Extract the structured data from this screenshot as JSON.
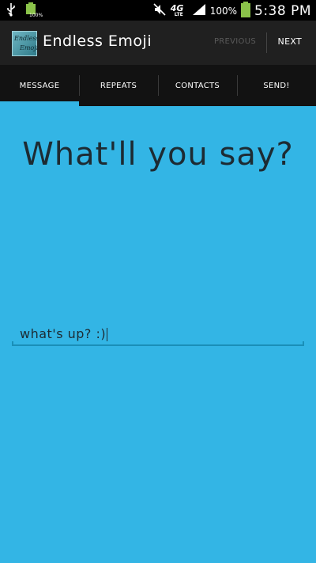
{
  "status_bar": {
    "battery_small_percent": "100%",
    "network_label": "4G",
    "network_sublabel": "LTE",
    "battery_percent": "100%",
    "time": "5:38 PM"
  },
  "action_bar": {
    "app_title": "Endless Emoji",
    "icon_text_line1": "Endless",
    "icon_text_line2": "Emoji",
    "previous_label": "PREVIOUS",
    "next_label": "NEXT"
  },
  "tabs": [
    {
      "label": "MESSAGE",
      "active": true
    },
    {
      "label": "REPEATS",
      "active": false
    },
    {
      "label": "CONTACTS",
      "active": false
    },
    {
      "label": "SEND!",
      "active": false
    }
  ],
  "main": {
    "heading": "What'll you say?",
    "message_value": "what's up? :)"
  },
  "colors": {
    "background": "#33b5e5",
    "action_bar": "#202020",
    "tab_bar": "#121212",
    "accent": "#33b5e5"
  }
}
